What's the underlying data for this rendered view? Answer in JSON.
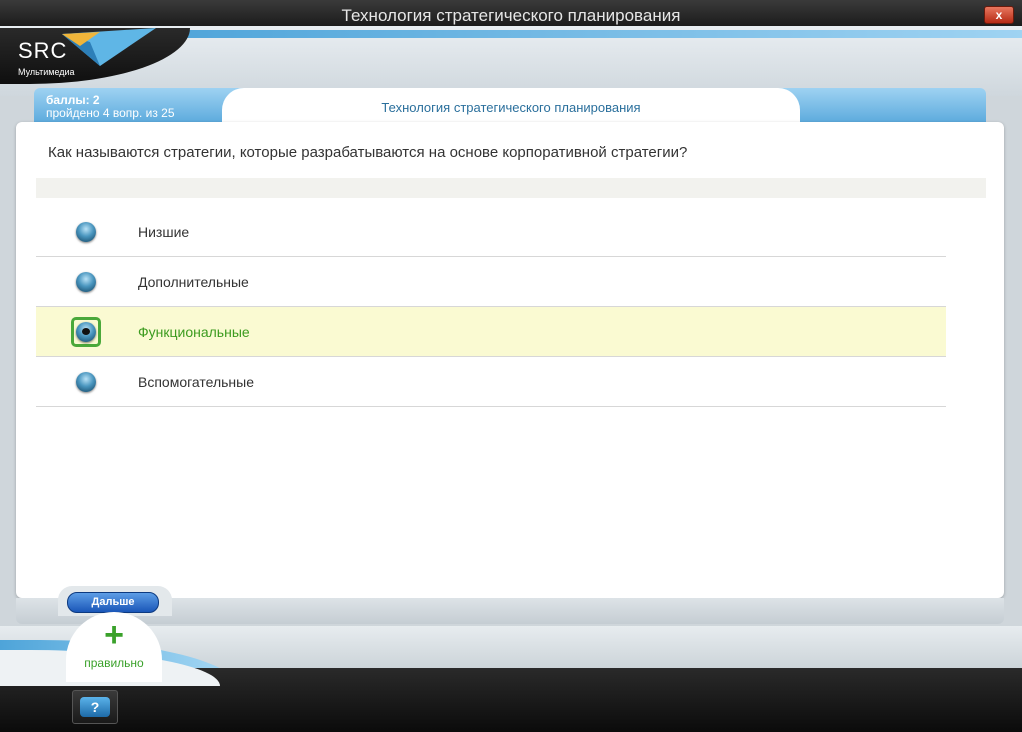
{
  "window": {
    "title": "Технология стратегического планирования",
    "close_label": "x"
  },
  "logo": {
    "brand": "SRC",
    "subtitle": "Мультимедиа"
  },
  "score": {
    "points": "баллы: 2",
    "progress": "пройдено  4  вопр.  из  25"
  },
  "tab": {
    "title": "Технология стратегического планирования"
  },
  "question": {
    "text": "Как называются стратегии, которые разрабатываются на основе корпоративной стратегии?"
  },
  "options": [
    {
      "label": "Низшие",
      "selected": false
    },
    {
      "label": "Дополнительные",
      "selected": false
    },
    {
      "label": "Функциональные",
      "selected": true
    },
    {
      "label": "Вспомогательные",
      "selected": false
    }
  ],
  "controls": {
    "next_label": "Дальше",
    "help_label": "?"
  },
  "feedback": {
    "icon": "plus-icon",
    "symbol": "+",
    "text": "правильно"
  },
  "colors": {
    "accent_blue": "#4ea4d9",
    "correct_green": "#3aa12a",
    "selected_bg": "#fafad2"
  }
}
